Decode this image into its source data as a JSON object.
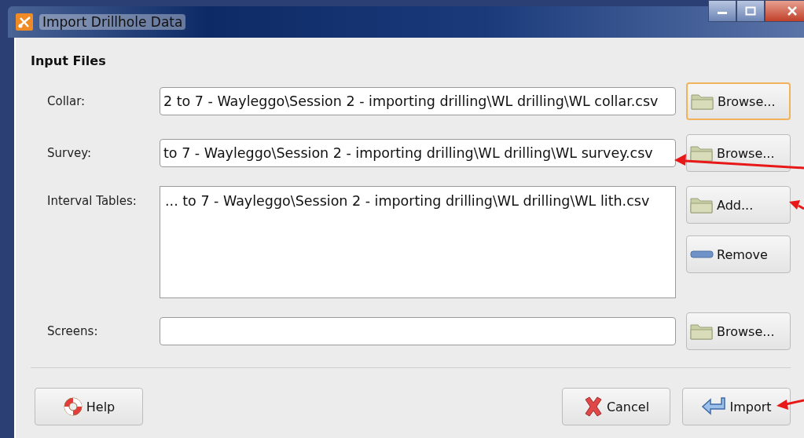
{
  "window": {
    "title": "Import Drillhole Data"
  },
  "section": {
    "title": "Input Files"
  },
  "rows": [
    {
      "kind": "field",
      "label": "Collar:",
      "value": "2 to 7 - Wayleggo\\Session 2 - importing drilling\\WL drilling\\WL collar.csv",
      "buttons": [
        {
          "kind": "folder",
          "label": "Browse...",
          "focused": true
        }
      ]
    },
    {
      "kind": "field",
      "label": "Survey:",
      "value": "to 7 - Wayleggo\\Session 2 - importing drilling\\WL drilling\\WL survey.csv",
      "buttons": [
        {
          "kind": "folder",
          "label": "Browse...",
          "focused": false
        }
      ]
    },
    {
      "kind": "list",
      "label": "Interval Tables:",
      "value": "... to 7 - Wayleggo\\Session 2 - importing drilling\\WL drilling\\WL lith.csv",
      "buttons": [
        {
          "kind": "folder",
          "label": "Add...",
          "focused": false
        },
        {
          "kind": "minus",
          "label": "Remove",
          "focused": false
        }
      ]
    },
    {
      "kind": "field",
      "label": "Screens:",
      "value": "",
      "buttons": [
        {
          "kind": "folder",
          "label": "Browse...",
          "focused": false
        }
      ]
    }
  ],
  "footer": {
    "left": [
      {
        "kind": "lifebuoy",
        "label": "Help"
      }
    ],
    "right": [
      {
        "kind": "cross",
        "label": "Cancel"
      },
      {
        "kind": "enter",
        "label": "Import"
      }
    ]
  }
}
